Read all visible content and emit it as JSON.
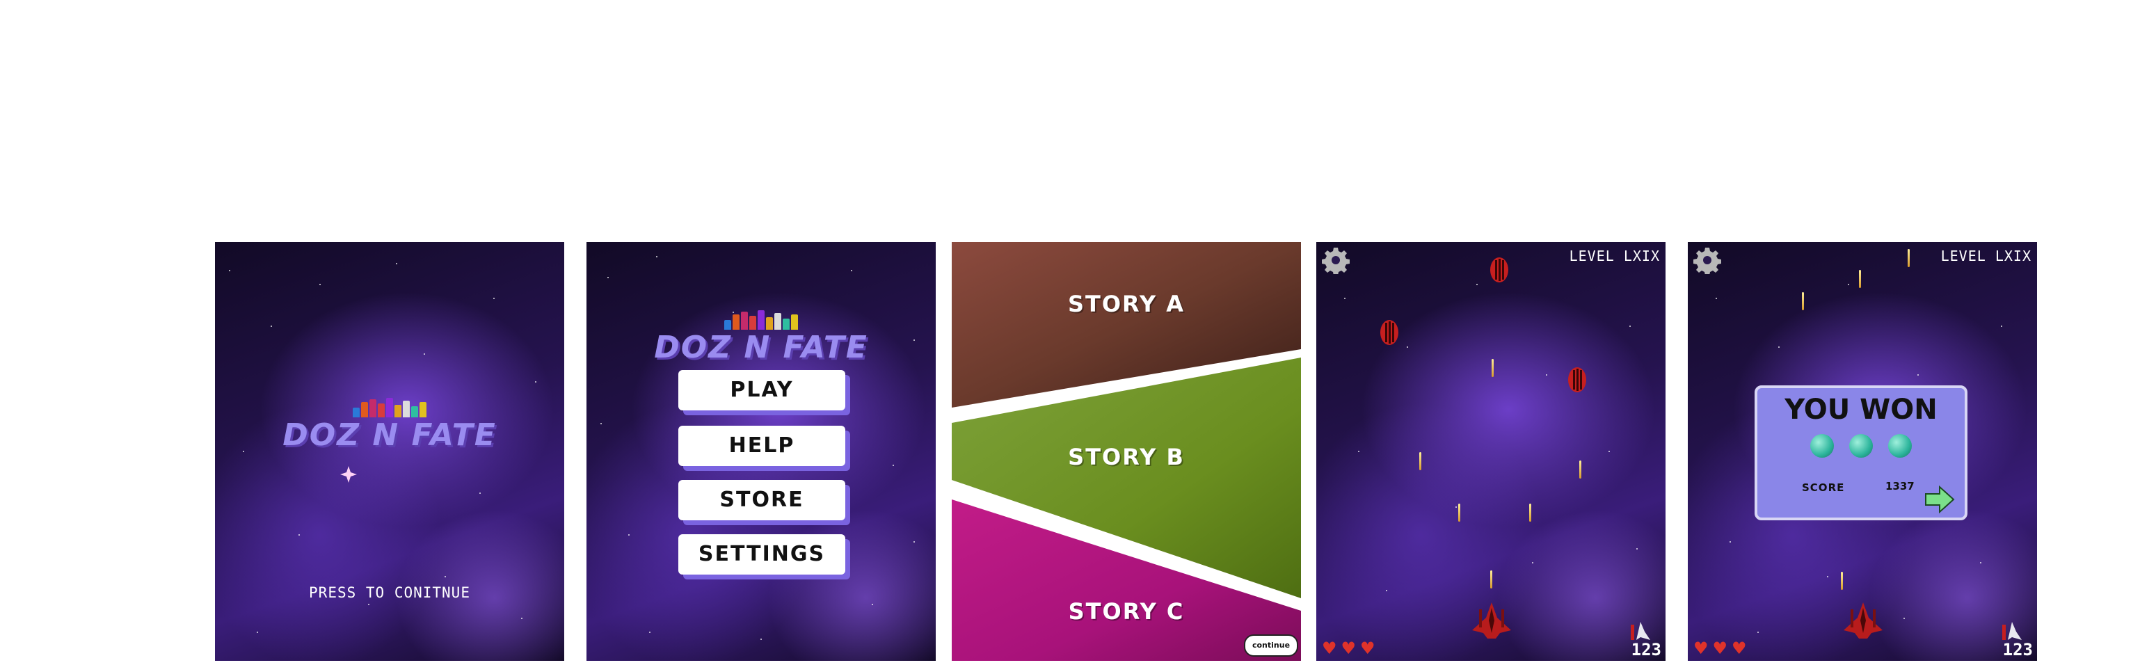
{
  "title_screen": {
    "logo_text": "DOZ N FATE",
    "prompt": "PRESS TO CONITNUE"
  },
  "main_menu": {
    "logo_text": "DOZ N FATE",
    "buttons": [
      {
        "label": "PLAY"
      },
      {
        "label": "HELP"
      },
      {
        "label": "STORE"
      },
      {
        "label": "SETTINGS"
      }
    ]
  },
  "story_select": {
    "stories": [
      {
        "label": "STORY A",
        "color": "#6b3a2a"
      },
      {
        "label": "STORY B",
        "color": "#6a8e1f"
      },
      {
        "label": "STORY C",
        "color": "#a8127a"
      }
    ],
    "continue_label": "continue"
  },
  "gameplay": {
    "level": "LEVEL LXIX",
    "lives": 3,
    "ammo": "123",
    "settings_icon": "gear-icon",
    "heart_icon": "heart-icon"
  },
  "win_screen": {
    "level": "LEVEL LXIX",
    "title": "YOU WON",
    "gems": 3,
    "score_label": "SCORE",
    "score_value": "1337",
    "lives": 3,
    "ammo": "123",
    "next_icon": "arrow-right-icon"
  },
  "colors": {
    "accent": "#9a8cf0",
    "button_shadow": "#7a63e0",
    "heart": "#e0332a",
    "dialog": "#8a86e8"
  }
}
